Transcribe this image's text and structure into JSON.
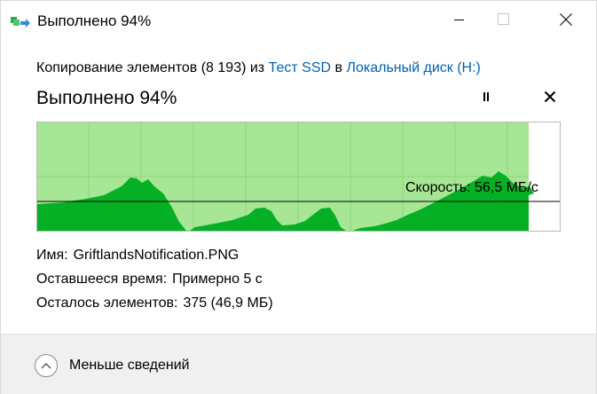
{
  "window": {
    "title": "Выполнено 94%",
    "icons": {
      "app": "copy-files-icon",
      "minimize": "minimize-icon",
      "maximize": "maximize-icon",
      "close": "close-icon"
    }
  },
  "copy": {
    "prefix": "Копирование элементов (8 193) из",
    "source": "Тест SSD",
    "middle": "в",
    "destination": "Локальный диск (H:)"
  },
  "progress": {
    "heading": "Выполнено 94%",
    "percent": 94,
    "pause_icon": "pause-icon",
    "cancel_icon": "cancel-icon"
  },
  "speed": {
    "label": "Скорость: 56,5 МБ/с"
  },
  "details": {
    "name_label": "Имя:",
    "name_value": "GriftlandsNotification.PNG",
    "time_label": "Оставшееся время:",
    "time_value": "Примерно 5 с",
    "items_label": "Осталось элементов:",
    "items_value": "375 (46,9 МБ)"
  },
  "footer": {
    "fewer_label": "Меньше сведений",
    "fewer_icon": "chevron-up-icon"
  },
  "colors": {
    "progress_fill": "#a6e695",
    "speed_fill": "#06b025",
    "grid": "#8fd77c",
    "link": "#0063b1"
  }
}
